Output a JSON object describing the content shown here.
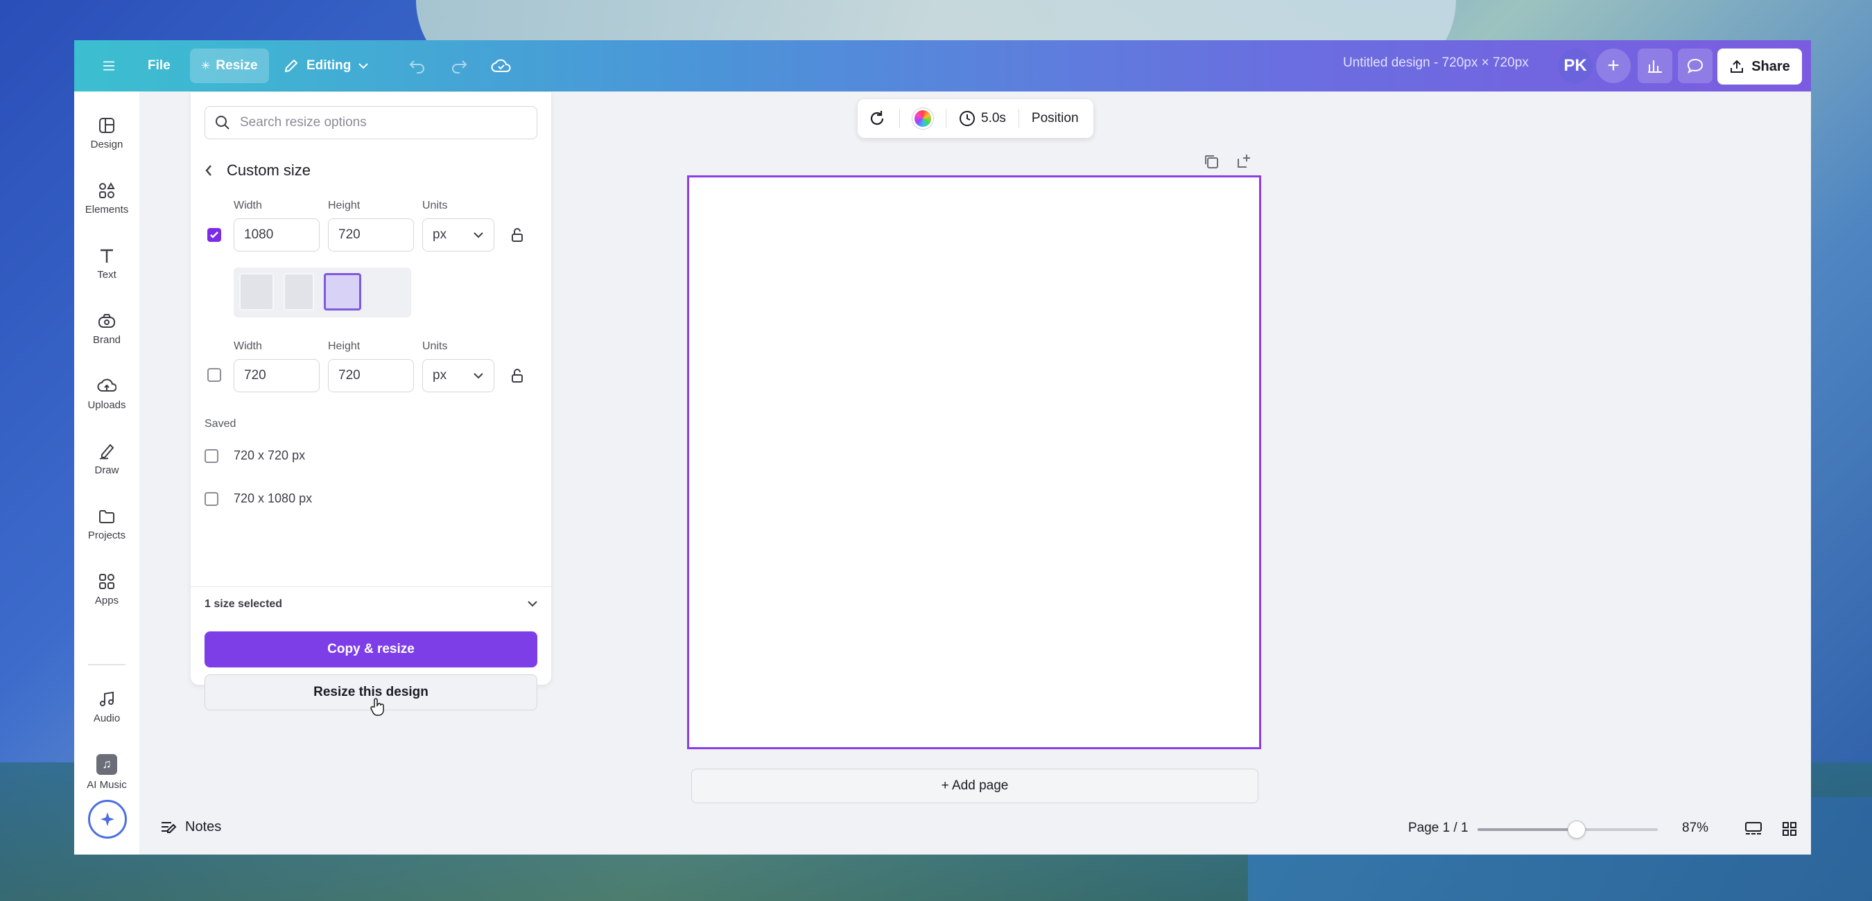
{
  "topbar": {
    "file_label": "File",
    "resize_label": "Resize",
    "editing_label": "Editing",
    "design_title": "Untitled design - 720px × 720px",
    "avatar_initials": "PK",
    "share_label": "Share"
  },
  "sidebar": {
    "items": [
      {
        "label": "Design",
        "icon": "layout-icon"
      },
      {
        "label": "Elements",
        "icon": "shapes-icon"
      },
      {
        "label": "Text",
        "icon": "text-icon"
      },
      {
        "label": "Brand",
        "icon": "brand-icon"
      },
      {
        "label": "Uploads",
        "icon": "upload-cloud-icon"
      },
      {
        "label": "Draw",
        "icon": "pen-icon"
      },
      {
        "label": "Projects",
        "icon": "folder-icon"
      },
      {
        "label": "Apps",
        "icon": "apps-icon"
      },
      {
        "label": "Audio",
        "icon": "music-note-icon"
      },
      {
        "label": "AI Music",
        "icon": "ai-music-icon"
      }
    ]
  },
  "resize_panel": {
    "search_placeholder": "Search resize options",
    "section_title": "Custom size",
    "labels": {
      "width": "Width",
      "height": "Height",
      "units": "Units"
    },
    "size1": {
      "width": "1080",
      "height": "720",
      "units": "px",
      "checked": true
    },
    "size2": {
      "width": "720",
      "height": "720",
      "units": "px",
      "checked": false
    },
    "saved_label": "Saved",
    "saved": [
      "720 x 720 px",
      "720 x 1080 px"
    ],
    "selected_count": "1 size selected",
    "copy_resize_label": "Copy & resize",
    "resize_this_label": "Resize this design"
  },
  "float_toolbar": {
    "duration": "5.0s",
    "position_label": "Position"
  },
  "canvas": {
    "add_page_label": "+ Add page"
  },
  "bottombar": {
    "notes_label": "Notes",
    "page_label": "Page 1 / 1",
    "zoom_label": "87%",
    "zoom_fraction": 0.55
  },
  "colors": {
    "accent": "#7d3ee8",
    "canvas_border": "#8b3ee8"
  }
}
